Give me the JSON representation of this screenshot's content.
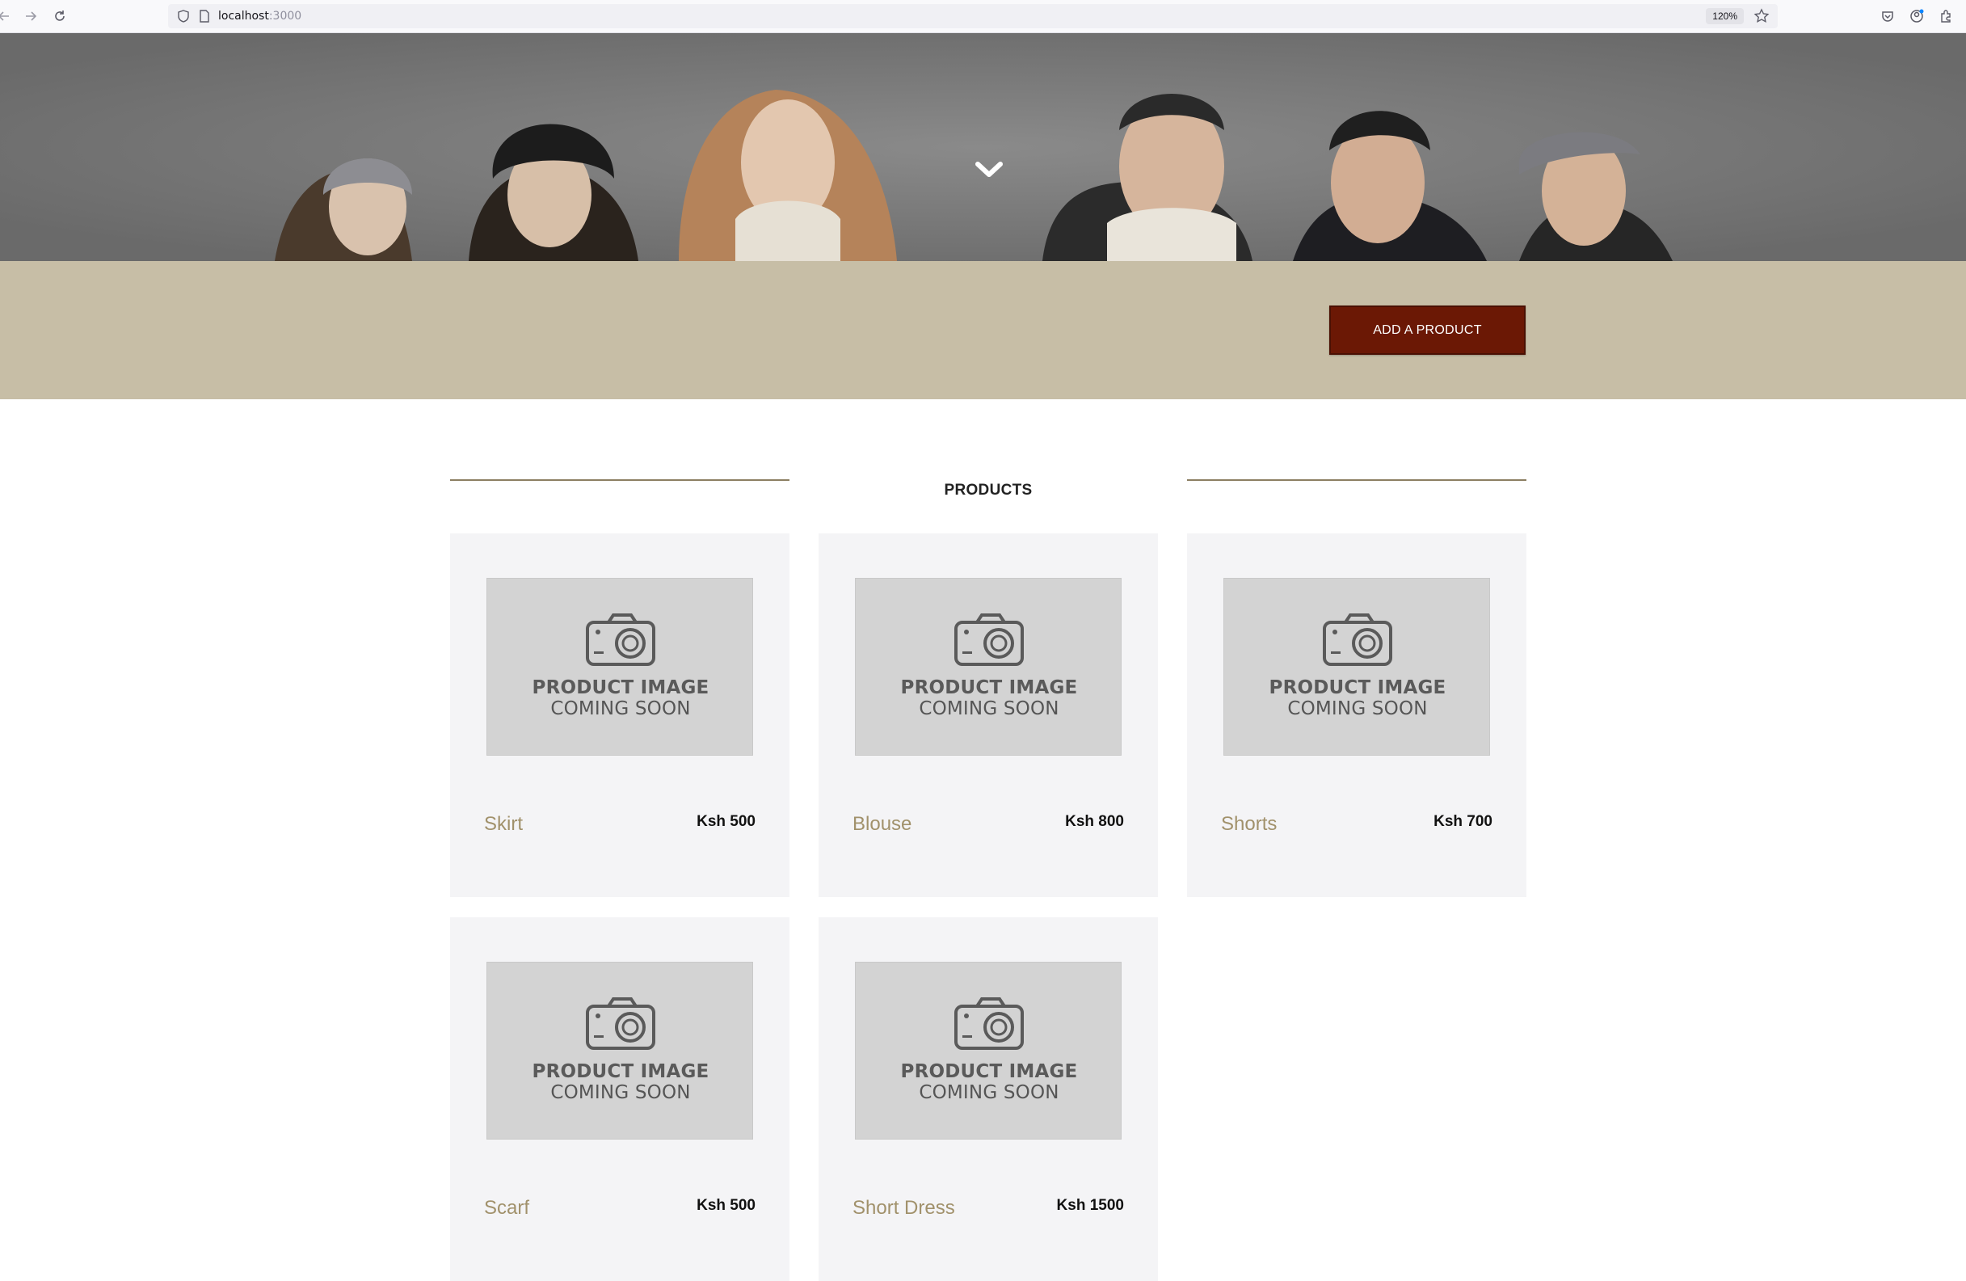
{
  "browser": {
    "url_host": "localhost",
    "url_port": ":3000",
    "zoom": "120%",
    "icons": [
      "back-icon",
      "forward-icon",
      "reload-icon",
      "shield-icon",
      "page-icon",
      "star-icon",
      "pocket-icon",
      "account-icon",
      "extensions-icon"
    ]
  },
  "hero": {
    "icon": "chevron-down-icon",
    "background": "#6f6f6f"
  },
  "band": {
    "add_product_label": "ADD A PRODUCT",
    "accent": "#6b1805",
    "background": "#c7bea6"
  },
  "products_section": {
    "title": "PRODUCTS",
    "placeholder_line1": "PRODUCT IMAGE",
    "placeholder_line2": "COMING SOON",
    "items": [
      {
        "name": "Skirt",
        "price": "Ksh 500"
      },
      {
        "name": "Blouse",
        "price": "Ksh 800"
      },
      {
        "name": "Shorts",
        "price": "Ksh 700"
      },
      {
        "name": "Scarf",
        "price": "Ksh 500"
      },
      {
        "name": "Short Dress",
        "price": "Ksh 1500"
      }
    ]
  }
}
